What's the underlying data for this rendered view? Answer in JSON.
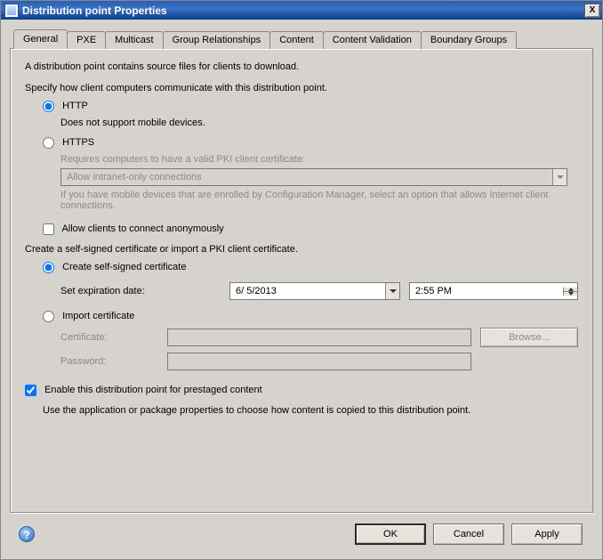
{
  "window": {
    "title": "Distribution point Properties",
    "close": "X"
  },
  "tabs": [
    {
      "label": "General"
    },
    {
      "label": "PXE"
    },
    {
      "label": "Multicast"
    },
    {
      "label": "Group Relationships"
    },
    {
      "label": "Content"
    },
    {
      "label": "Content Validation"
    },
    {
      "label": "Boundary Groups"
    }
  ],
  "general": {
    "intro": "A distribution point contains source files for clients to download.",
    "specify": "Specify how client computers communicate with this distribution point.",
    "http": {
      "label": "HTTP",
      "note": "Does not support mobile devices."
    },
    "https": {
      "label": "HTTPS",
      "req": "Requires computers to have a valid PKI client certificate:",
      "combo": "Allow intranet-only connections",
      "note": "If you have mobile devices that are enrolled by Configuration Manager, select an option that allows Internet client connections."
    },
    "anon": "Allow clients to connect anonymously",
    "certsection": "Create a self-signed certificate or import a PKI client certificate.",
    "createcert": {
      "label": "Create self-signed certificate",
      "datelabel": "Set expiration date:",
      "date": "6/  5/2013",
      "time": "2:55 PM"
    },
    "importcert": {
      "label": "Import certificate",
      "cert_label": "Certificate:",
      "cert_value": "",
      "pass_label": "Password:",
      "pass_value": "",
      "browse": "Browse..."
    },
    "prestaged": {
      "label": "Enable this distribution point for prestaged content",
      "note": "Use the application or package properties to choose how content is copied to this distribution point."
    }
  },
  "buttons": {
    "ok": "OK",
    "cancel": "Cancel",
    "apply": "Apply",
    "help": "?"
  }
}
